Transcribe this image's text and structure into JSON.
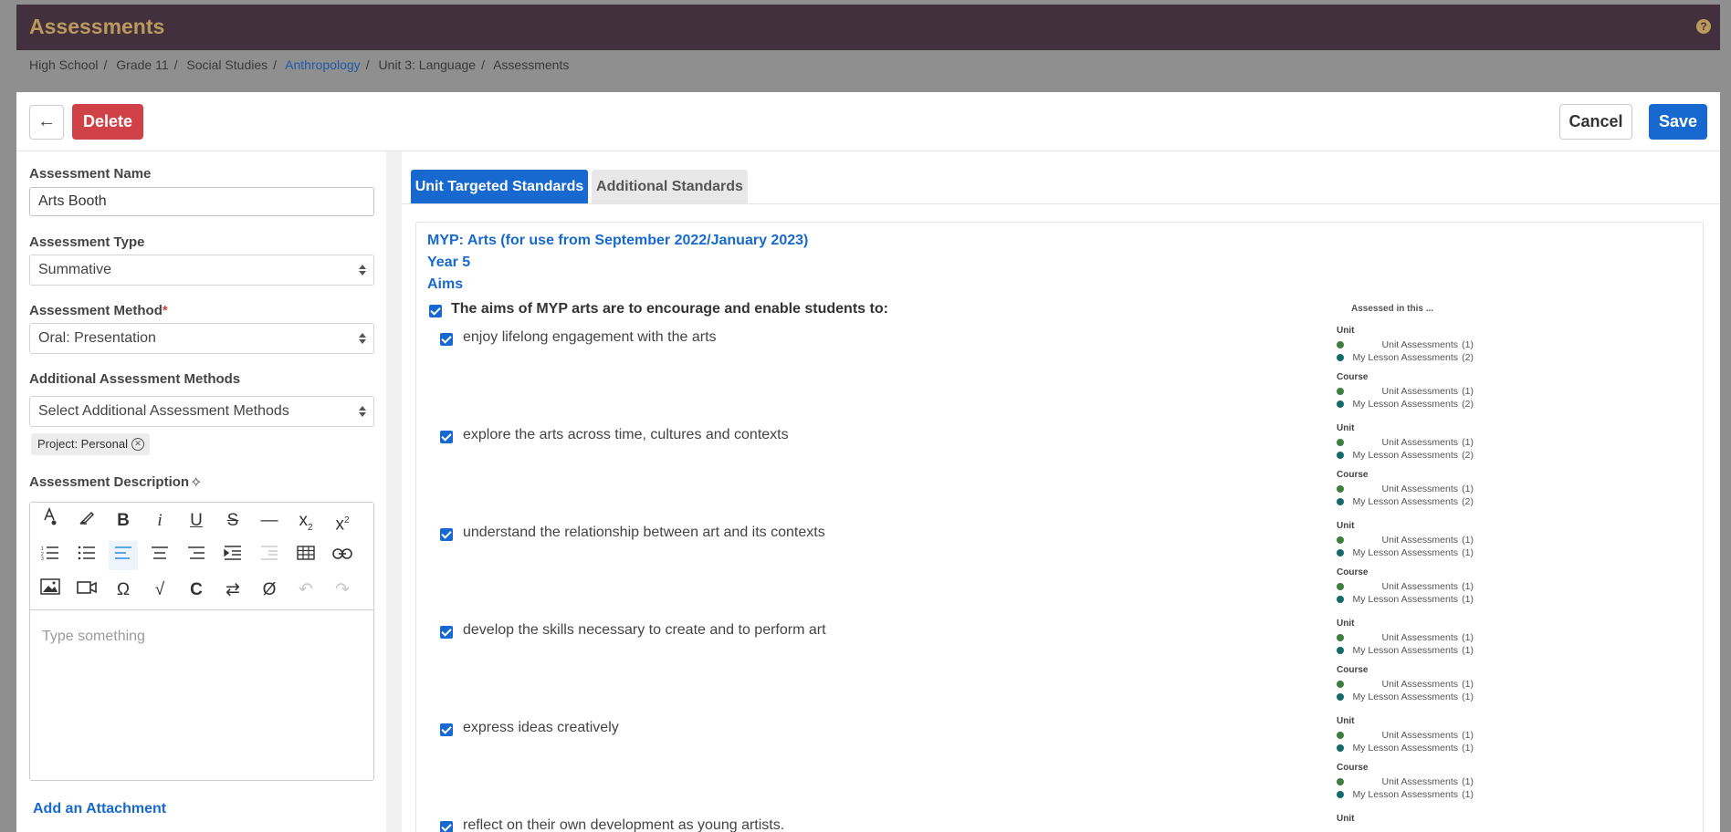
{
  "header": {
    "title": "Assessments",
    "help_icon": "?"
  },
  "breadcrumb": [
    "High School",
    "Grade 11",
    "Social Studies",
    "Anthropology",
    "Unit 3: Language",
    "Assessments"
  ],
  "actions": {
    "back": "←",
    "delete": "Delete",
    "cancel": "Cancel",
    "save": "Save"
  },
  "form": {
    "name_label": "Assessment Name",
    "name_value": "Arts Booth",
    "type_label": "Assessment Type",
    "type_value": "Summative",
    "method_label": "Assessment Method",
    "method_required": "*",
    "method_value": "Oral: Presentation",
    "additional_label": "Additional Assessment Methods",
    "additional_placeholder": "Select Additional Assessment Methods",
    "tag": "Project: Personal",
    "description_label": "Assessment Description",
    "editor_placeholder": "Type something",
    "attachment_link": "Add an Attachment"
  },
  "toolbar_icons": [
    [
      "font-color-icon",
      "highlight-icon",
      "bold-icon",
      "italic-icon",
      "underline-icon",
      "strikethrough-icon",
      "horizontal-rule-icon",
      "subscript-icon",
      "superscript-icon"
    ],
    [
      "ordered-list-icon",
      "bullet-list-icon",
      "align-left-icon",
      "align-center-icon",
      "align-right-icon",
      "indent-icon",
      "outdent-icon",
      "table-icon",
      "link-icon"
    ],
    [
      "image-icon",
      "video-icon",
      "special-char-icon",
      "math-icon",
      "code-icon",
      "replace-icon",
      "clear-format-icon",
      "undo-icon",
      "redo-icon"
    ]
  ],
  "tabs": {
    "active": "Unit Targeted Standards",
    "other": "Additional Standards"
  },
  "standard": {
    "framework": "MYP: Arts (for use from September 2022/January 2023)",
    "year": "Year 5",
    "section": "Aims",
    "parent": "The aims of MYP arts are to encourage and enable students to:",
    "assessed_title": "Assessed in this ...",
    "items": [
      {
        "text": "enjoy lifelong engagement with the arts",
        "stats": {
          "unit_label": "Unit",
          "course_label": "Course",
          "unit": [
            [
              "Unit Assessments",
              "(1)"
            ],
            [
              "My Lesson Assessments",
              "(2)"
            ]
          ],
          "course": [
            [
              "Unit Assessments",
              "(1)"
            ],
            [
              "My Lesson Assessments",
              "(2)"
            ]
          ]
        }
      },
      {
        "text": "explore the arts across time, cultures and contexts",
        "stats": {
          "unit_label": "Unit",
          "course_label": "Course",
          "unit": [
            [
              "Unit Assessments",
              "(1)"
            ],
            [
              "My Lesson Assessments",
              "(2)"
            ]
          ],
          "course": [
            [
              "Unit Assessments",
              "(1)"
            ],
            [
              "My Lesson Assessments",
              "(2)"
            ]
          ]
        }
      },
      {
        "text": "understand the relationship between art and its contexts",
        "stats": {
          "unit_label": "Unit",
          "course_label": "Course",
          "unit": [
            [
              "Unit Assessments",
              "(1)"
            ],
            [
              "My Lesson Assessments",
              "(1)"
            ]
          ],
          "course": [
            [
              "Unit Assessments",
              "(1)"
            ],
            [
              "My Lesson Assessments",
              "(1)"
            ]
          ]
        }
      },
      {
        "text": "develop the skills necessary to create and to perform art",
        "stats": {
          "unit_label": "Unit",
          "course_label": "Course",
          "unit": [
            [
              "Unit Assessments",
              "(1)"
            ],
            [
              "My Lesson Assessments",
              "(1)"
            ]
          ],
          "course": [
            [
              "Unit Assessments",
              "(1)"
            ],
            [
              "My Lesson Assessments",
              "(1)"
            ]
          ]
        }
      },
      {
        "text": "express ideas creatively",
        "stats": {
          "unit_label": "Unit",
          "course_label": "Course",
          "unit": [
            [
              "Unit Assessments",
              "(1)"
            ],
            [
              "My Lesson Assessments",
              "(1)"
            ]
          ],
          "course": [
            [
              "Unit Assessments",
              "(1)"
            ],
            [
              "My Lesson Assessments",
              "(1)"
            ]
          ]
        }
      },
      {
        "text": "reflect on their own development as young artists.",
        "stats": {
          "unit_label": "Unit",
          "course_label": "",
          "unit": [],
          "course": []
        }
      }
    ]
  },
  "colors": {
    "header_bg": "#42303f",
    "header_title": "#b99a5c",
    "primary": "#1769d0",
    "danger": "#cf4146",
    "dot_unit": "#3e7d3c",
    "dot_lesson": "#146a6a"
  }
}
